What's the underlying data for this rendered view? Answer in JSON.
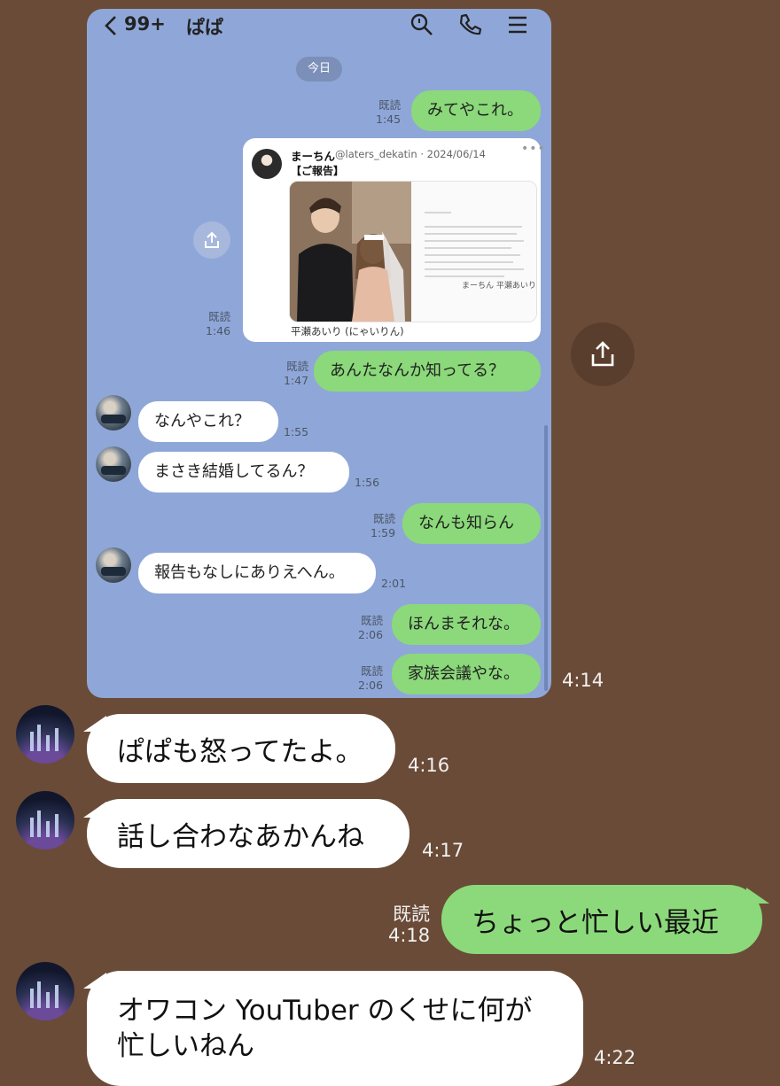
{
  "screenshot": {
    "header": {
      "back_count": "99+",
      "title": "ぱぱ",
      "icons": [
        "search-icon",
        "phone-icon",
        "menu-icon"
      ]
    },
    "date_chip": "今日",
    "messages": [
      {
        "side": "right",
        "read": "既読",
        "time": "1:45",
        "text": "みてやこれ。"
      },
      {
        "side": "right",
        "read": "既読",
        "time": "1:46",
        "type": "shared-post"
      },
      {
        "side": "right",
        "read": "既読",
        "time": "1:47",
        "text": "あんたなんか知ってる？"
      },
      {
        "side": "left",
        "time": "1:55",
        "text": "なんやこれ？"
      },
      {
        "side": "left",
        "time": "1:56",
        "text": "まさき結婚してるん？"
      },
      {
        "side": "right",
        "read": "既読",
        "time": "1:59",
        "text": "なんも知らん"
      },
      {
        "side": "left",
        "time": "2:01",
        "text": "報告もなしにありえへん。"
      },
      {
        "side": "right",
        "read": "既読",
        "time": "2:06",
        "text": "ほんまそれな。"
      },
      {
        "side": "right",
        "read": "既読",
        "time": "2:06",
        "text": "家族会議やな。"
      }
    ],
    "card": {
      "name": "まーちん",
      "handle": "@laters_dekatin · 2024/06/14",
      "title": "【ご報告】",
      "caption": "平瀬あいり (にゃいりん)",
      "doc_signature": "まーちん 平瀬あいり"
    }
  },
  "outer": {
    "screenshot_time": "4:14",
    "messages": [
      {
        "side": "left",
        "time": "4:16",
        "text": "ぱぱも怒ってたよ。"
      },
      {
        "side": "left",
        "time": "4:17",
        "text": "話し合わなあかんね"
      },
      {
        "side": "right",
        "read": "既読",
        "time": "4:18",
        "text": "ちょっと忙しい最近"
      },
      {
        "side": "left",
        "time": "4:22",
        "text_line1": "オワコン YouTuber のくせに何が",
        "text_line2": "忙しいねん"
      }
    ]
  },
  "colors": {
    "bg": "#6a4b37",
    "green_bubble": "#8bd97a",
    "chat_bg": "#8fa7d8"
  }
}
